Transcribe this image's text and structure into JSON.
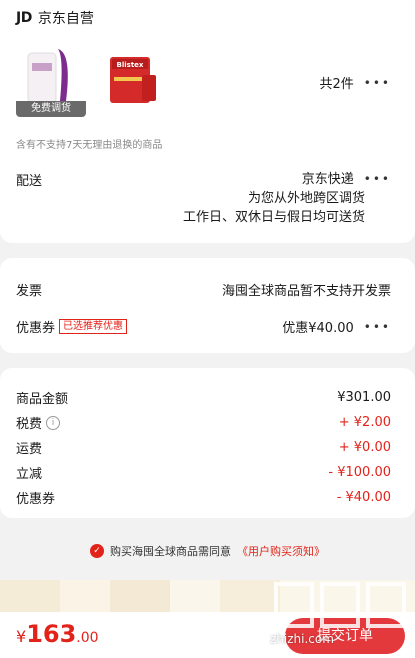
{
  "store": {
    "logo": "JD",
    "name": "京东自营"
  },
  "products": {
    "badge": "免费调货",
    "brand2": "Blistex",
    "count": "共2件"
  },
  "notice": "含有不支持7天无理由退换的商品",
  "shipping": {
    "label": "配送",
    "method": "京东快递",
    "line2": "为您从外地跨区调货",
    "line3": "工作日、双休日与假日均可送货"
  },
  "invoice": {
    "label": "发票",
    "value": "海囤全球商品暂不支持开发票"
  },
  "coupon": {
    "label": "优惠券",
    "tag": "已选推荐优惠",
    "value": "优惠¥40.00"
  },
  "amounts": [
    {
      "label": "商品金额",
      "value": "¥301.00",
      "red": false,
      "info": false
    },
    {
      "label": "税费",
      "value": "+ ¥2.00",
      "red": true,
      "info": true
    },
    {
      "label": "运费",
      "value": "+ ¥0.00",
      "red": true,
      "info": false
    },
    {
      "label": "立减",
      "value": "- ¥100.00",
      "red": true,
      "info": false
    },
    {
      "label": "优惠券",
      "value": "- ¥40.00",
      "red": true,
      "info": false
    }
  ],
  "agreement": {
    "text": "购买海囤全球商品需同意",
    "link": "《用户购买须知》"
  },
  "total": {
    "currency": "¥",
    "integer": "163",
    "decimal": ".00"
  },
  "submit_label": "提交订单",
  "watermark": "zhizhi.com",
  "colors": {
    "accent": "#e2231a",
    "background": "#f2f2f2"
  }
}
